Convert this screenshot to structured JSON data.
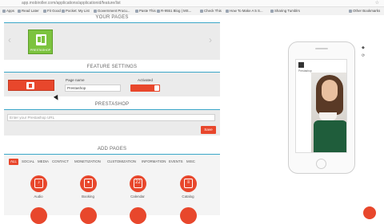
{
  "browser": {
    "url": "app.mobiroller.com/applications/applicationid/feature/list",
    "bookmarks": [
      "Apps",
      "Read Later",
      "Fit Good",
      "Pocket: My List",
      "Government Procu...",
      "Paste This",
      "R-9551 Blog | MS...",
      "Check This",
      "How To Make A 5 S...",
      "Sharing Tumblrs",
      "Other Bookmarks"
    ]
  },
  "your_pages": {
    "title": "YOUR PAGES",
    "app_tile_label": "PRESTASHOP"
  },
  "feature_settings": {
    "title": "FEATURE SETTINGS",
    "page_name_label": "Page name",
    "page_name_value": "Prestashop",
    "activated_label": "Activated"
  },
  "prestashop": {
    "title": "PRESTASHOP",
    "url_placeholder": "Enter your Prestashop URL",
    "save_label": "Save"
  },
  "add_pages": {
    "title": "ADD PAGES",
    "tabs": [
      "ALL",
      "SOCIAL",
      "MEDIA",
      "CONTACT",
      "MONETIZATION",
      "CUSTOMIZATION",
      "INFORMATION",
      "EVENTS",
      "MISC"
    ],
    "items": [
      {
        "label": "Audio"
      },
      {
        "label": "Booking"
      },
      {
        "label": "Calendar",
        "badge": "22"
      },
      {
        "label": "Catalog"
      }
    ]
  },
  "preview": {
    "screen_title": "Prestashop"
  },
  "colors": {
    "accent": "#e8472c",
    "teal": "#3aa6c8",
    "tile_green": "#7cc33f"
  }
}
